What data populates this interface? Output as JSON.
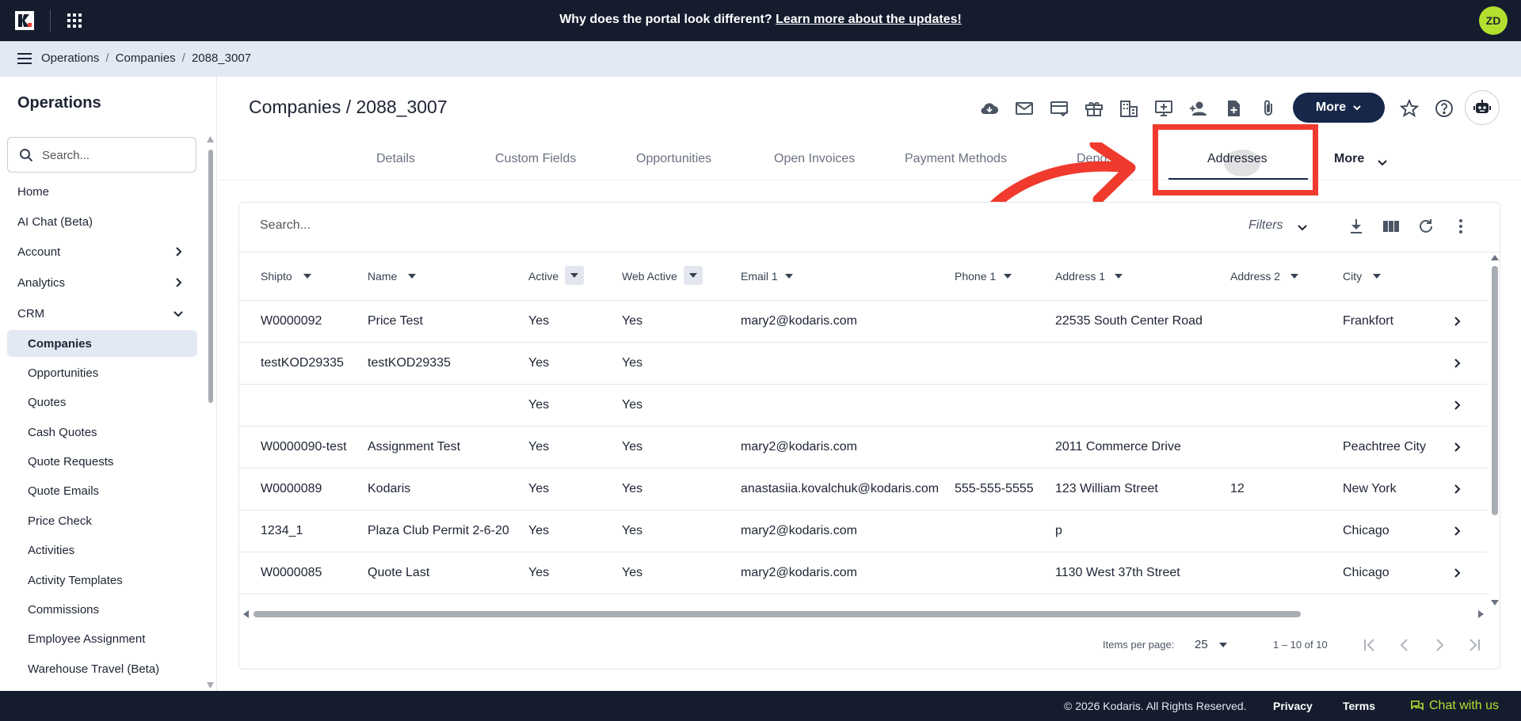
{
  "colors": {
    "topbar_bg": "#141c2e",
    "accent_primary": "#16274a",
    "avatar_bg": "#b3e02f",
    "highlight_red": "#f03a2e",
    "crumb_bg": "#e3e9f4"
  },
  "banner": {
    "text": "Why does the portal look different?",
    "link": "Learn more about the updates!"
  },
  "user": {
    "initials": "ZD"
  },
  "breadcrumb": [
    "Operations",
    "Companies",
    "2088_3007"
  ],
  "sidebar": {
    "title": "Operations",
    "search_placeholder": "Search...",
    "items": [
      {
        "label": "Home"
      },
      {
        "label": "AI Chat (Beta)"
      },
      {
        "label": "Account"
      },
      {
        "label": "Analytics"
      },
      {
        "label": "CRM"
      }
    ],
    "crm_children": [
      {
        "label": "Companies",
        "active": true
      },
      {
        "label": "Opportunities"
      },
      {
        "label": "Quotes"
      },
      {
        "label": "Cash Quotes"
      },
      {
        "label": "Quote Requests"
      },
      {
        "label": "Quote Emails"
      },
      {
        "label": "Price Check"
      },
      {
        "label": "Activities"
      },
      {
        "label": "Activity Templates"
      },
      {
        "label": "Commissions"
      },
      {
        "label": "Employee Assignment"
      },
      {
        "label": "Warehouse Travel (Beta)"
      }
    ]
  },
  "page": {
    "title": "Companies / 2088_3007",
    "more_label": "More",
    "action_icons": [
      "cloud-download-icon",
      "mail-icon",
      "card-check-icon",
      "gift-icon",
      "buildings-icon",
      "monitor-add-icon",
      "person-add-icon",
      "file-add-icon",
      "paperclip-icon"
    ]
  },
  "tabs": [
    "Details",
    "Custom Fields",
    "Opportunities",
    "Open Invoices",
    "Payment Methods",
    "Depos",
    "Addresses"
  ],
  "active_tab": "Addresses",
  "tabs_more_label": "More",
  "table": {
    "search_placeholder": "Search...",
    "filters_label": "Filters",
    "columns": [
      "Shipto",
      "Name",
      "Active",
      "Web Active",
      "Email 1",
      "Phone 1",
      "Address 1",
      "Address 2",
      "City"
    ],
    "rows": [
      [
        "W0000092",
        "Price Test",
        "Yes",
        "Yes",
        "mary2@kodaris.com",
        "",
        "22535 South Center Road",
        "",
        "Frankfort"
      ],
      [
        "testKOD29335",
        "testKOD29335",
        "Yes",
        "Yes",
        "",
        "",
        "",
        "",
        ""
      ],
      [
        "",
        "",
        "Yes",
        "Yes",
        "",
        "",
        "",
        "",
        ""
      ],
      [
        "W0000090-test",
        "Assignment Test",
        "Yes",
        "Yes",
        "mary2@kodaris.com",
        "",
        "2011 Commerce Drive",
        "",
        "Peachtree City"
      ],
      [
        "W0000089",
        "Kodaris",
        "Yes",
        "Yes",
        "anastasiia.kovalchuk@kodaris.com",
        "555-555-5555",
        "123 William Street",
        "12",
        "New York"
      ],
      [
        "1234_1",
        "Plaza Club Permit 2-6-20",
        "Yes",
        "Yes",
        "mary2@kodaris.com",
        "",
        "p",
        "",
        "Chicago"
      ],
      [
        "W0000085",
        "Quote Last",
        "Yes",
        "Yes",
        "mary2@kodaris.com",
        "",
        "1130 West 37th Street",
        "",
        "Chicago"
      ]
    ]
  },
  "paginator": {
    "items_per_page_label": "Items per page:",
    "page_size": "25",
    "range": "1 – 10 of 10"
  },
  "footer": {
    "copyright": "© 2026 Kodaris. All Rights Reserved.",
    "privacy": "Privacy",
    "terms": "Terms",
    "chat": "Chat with us"
  }
}
